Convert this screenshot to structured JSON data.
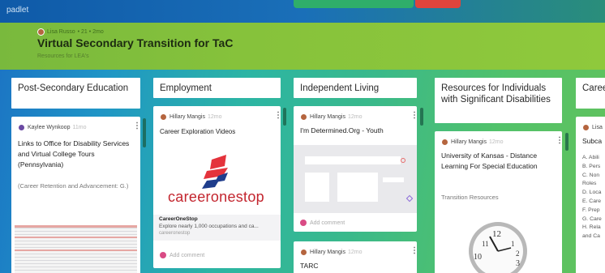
{
  "app": {
    "brand": "padlet"
  },
  "header": {
    "author": "Lisa Russo",
    "meta": "• 21 • 2mo",
    "title": "Virtual Secondary Transition for TaC",
    "subtitle": "Resources for LEA's"
  },
  "columns": [
    {
      "title": "Post-Secondary Education"
    },
    {
      "title": "Employment"
    },
    {
      "title": "Independent Living"
    },
    {
      "title": "Resources for Individuals with Significant Disabilities"
    },
    {
      "title": "Caree Prepa"
    }
  ],
  "cards": {
    "c1": {
      "author": "Kaylee Wynkoop",
      "time": "11mo",
      "title": "Links to Office for Disability Services and Virtual College Tours (Pennsylvania)",
      "body": "(Career Retention and Advancement: G.)"
    },
    "c2": {
      "author": "Hillary Mangis",
      "time": "12mo",
      "title": "Career Exploration Videos",
      "logo_text": "careeronestop",
      "link_title": "CareerOneStop",
      "link_desc": "Explore nearly 1,000 occupations and ca...",
      "link_domain": "careeronestop",
      "comment": "Add comment"
    },
    "c3": {
      "author": "Hillary Mangis",
      "time": "12mo",
      "title": "I'm Determined.Org - Youth",
      "comment": "Add comment"
    },
    "c4": {
      "author": "Hillary Mangis",
      "time": "12mo",
      "title": "TARC"
    },
    "c5": {
      "author": "Hillary Mangis",
      "time": "12mo",
      "title": "University of Kansas - Distance Learning For Special Education",
      "body": "Transition Resources"
    },
    "c6": {
      "author": "Lisa",
      "title": "Subca",
      "items": [
        "A. Abili",
        "B. Pers",
        "C. Non",
        "Roles",
        "D. Loca",
        "E. Care",
        "F. Prep",
        "G. Care",
        "H. Rela",
        "and Ca"
      ]
    }
  },
  "colors": {
    "accent_red": "#e0443c",
    "accent_green": "#2fae6a",
    "comment_pink": "#d94b85"
  }
}
